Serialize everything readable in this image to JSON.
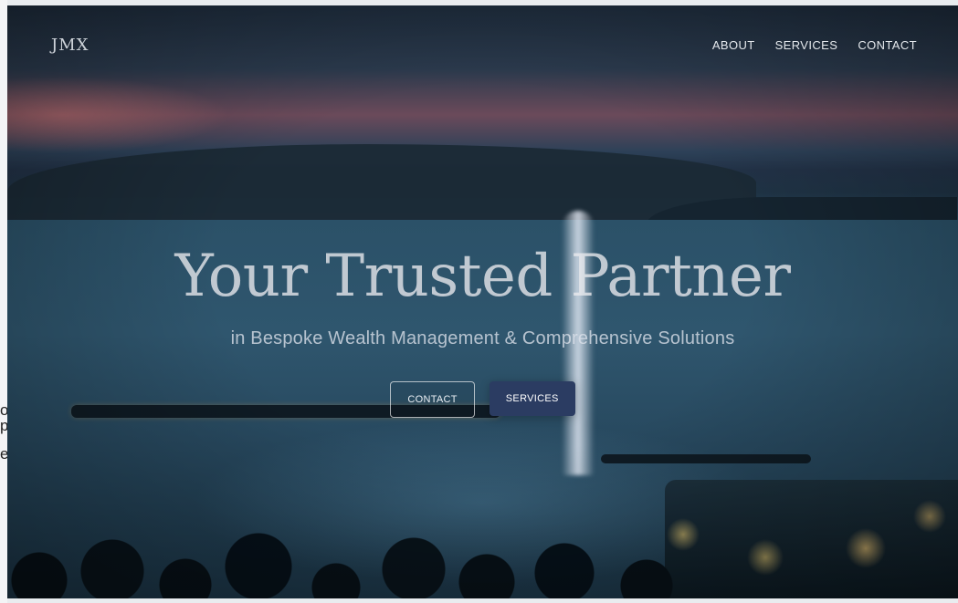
{
  "brand": {
    "logo_text": "JMX"
  },
  "nav": {
    "items": [
      {
        "label": "ABOUT"
      },
      {
        "label": "SERVICES"
      },
      {
        "label": "CONTACT"
      }
    ]
  },
  "hero": {
    "headline": "Your Trusted Partner",
    "subheadline": "in Bespoke Wealth Management & Comprehensive Solutions",
    "buttons": {
      "contact": "CONTACT",
      "services": "SERVICES"
    }
  },
  "colors": {
    "button_primary_bg": "#2b3c62",
    "hero_text": "#eaeaee"
  },
  "left_edge_fragments": [
    "o",
    "p",
    "er"
  ]
}
